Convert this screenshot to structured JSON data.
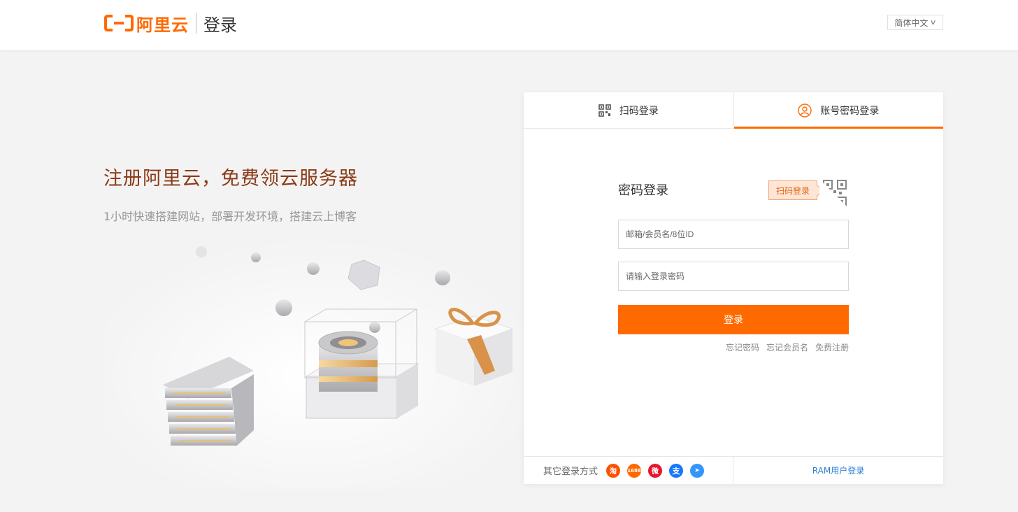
{
  "header": {
    "brand": "阿里云",
    "page_title": "登录",
    "language": "简体中文"
  },
  "hero": {
    "title": "注册阿里云，免费领云服务器",
    "subtitle": "1小时快速搭建网站，部署开发环境，搭建云上博客"
  },
  "tabs": [
    {
      "label": "扫码登录",
      "icon": "qr-code-icon",
      "active": false
    },
    {
      "label": "账号密码登录",
      "icon": "user-icon",
      "active": true
    }
  ],
  "form": {
    "title": "密码登录",
    "qr_tip": "扫码登录",
    "username_placeholder": "邮箱/会员名/8位ID",
    "password_placeholder": "请输入登录密码",
    "submit_label": "登录",
    "links": [
      "忘记密码",
      "忘记会员名",
      "免费注册"
    ]
  },
  "footer": {
    "other_label": "其它登录方式",
    "social": [
      {
        "name": "taobao-icon",
        "text": "淘",
        "color": "#ff5000"
      },
      {
        "name": "1688-icon",
        "text": "1688",
        "color": "#ff6a00"
      },
      {
        "name": "weibo-icon",
        "text": "微",
        "color": "#e6162d"
      },
      {
        "name": "alipay-icon",
        "text": "支",
        "color": "#1677ff"
      },
      {
        "name": "dingtalk-icon",
        "text": "➤",
        "color": "#3296fa"
      }
    ],
    "ram_login": "RAM用户登录"
  },
  "colors": {
    "accent": "#ff6a00",
    "link": "#2d7fd3",
    "hero_title": "#8a3b16"
  }
}
